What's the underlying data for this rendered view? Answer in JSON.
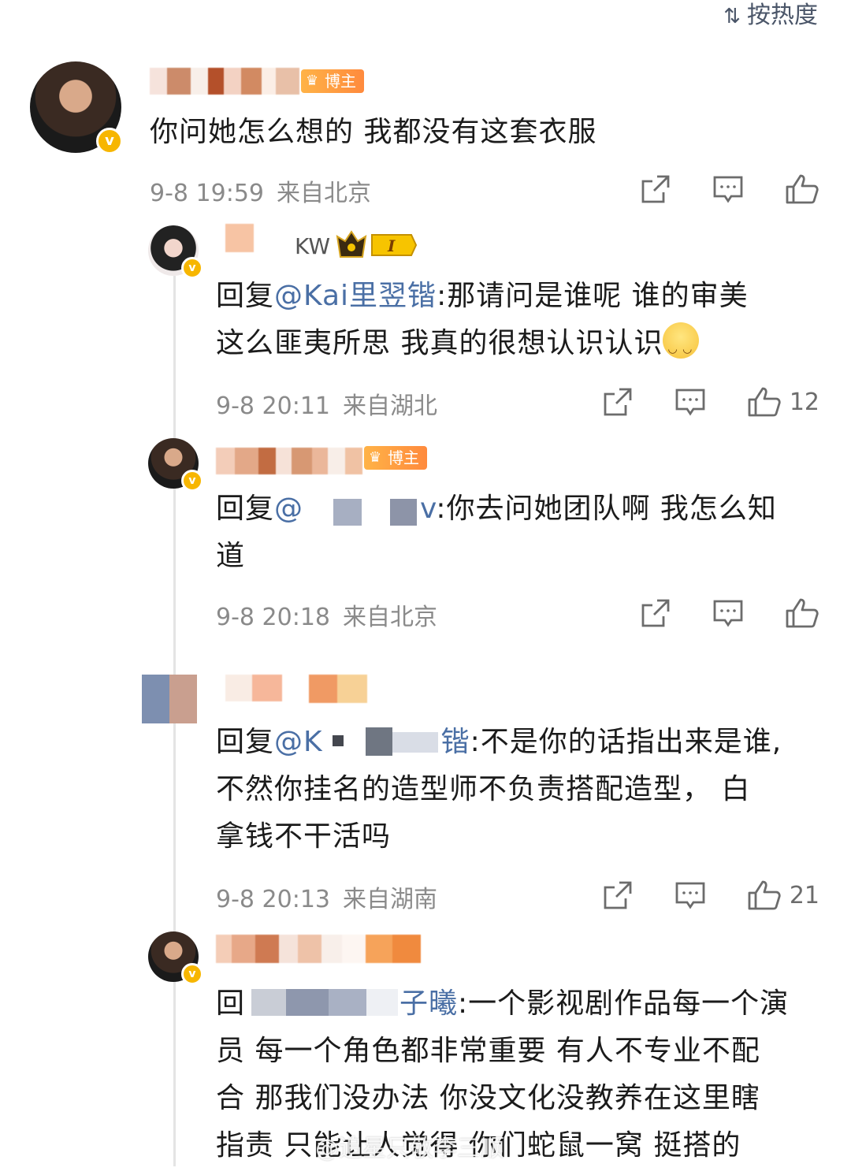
{
  "sort": {
    "label": "按热度",
    "icon": "sort-icon"
  },
  "comment": {
    "text": "你问她怎么想的 我都没有这套衣服",
    "time": "9-8 19:59",
    "location": "来自北京",
    "tag": "博主"
  },
  "replies": [
    {
      "name_visible": "KW",
      "prefix": "回复",
      "mention": "@Kai里翌锴",
      "text_line1": ":那请问是谁呢 谁的审美",
      "text_line2": "这么匪夷所思 我真的很想认识认识",
      "time": "9-8 20:11",
      "location": "来自湖北",
      "likes": "12"
    },
    {
      "tag": "博主",
      "prefix": "回复",
      "mention": "@",
      "mention_tail": "v",
      "text_line1": ":你去问她团队啊 我怎么知",
      "text_line2": "道",
      "time": "9-8 20:18",
      "location": "来自北京"
    },
    {
      "prefix": "回复",
      "mention": "@K",
      "mention_tail": "锴",
      "text_line1": ":不是你的话指出来是谁,",
      "text_line2": "不然你挂名的造型师不负责搭配造型， 白",
      "text_line3": "拿钱不干活吗",
      "time": "9-8 20:13",
      "location": "来自湖南",
      "likes": "21"
    },
    {
      "prefix": "回",
      "mention_tail": "子曦",
      "text_line1": ":一个影视剧作品每一个演",
      "text_line2": "员 每一个角色都非常重要 有人不专业不配",
      "text_line3": "合 那我们没办法 你没文化没教养在这里瞎",
      "text_line4": "指责 只能让人觉得 你们蛇鼠一窝 挺搭的"
    }
  ],
  "watermark": "@追星只敬李三顺",
  "colors": {
    "mention": "#4a6fa5",
    "badge": "#f7b600",
    "tag": "#ff8a3d"
  }
}
